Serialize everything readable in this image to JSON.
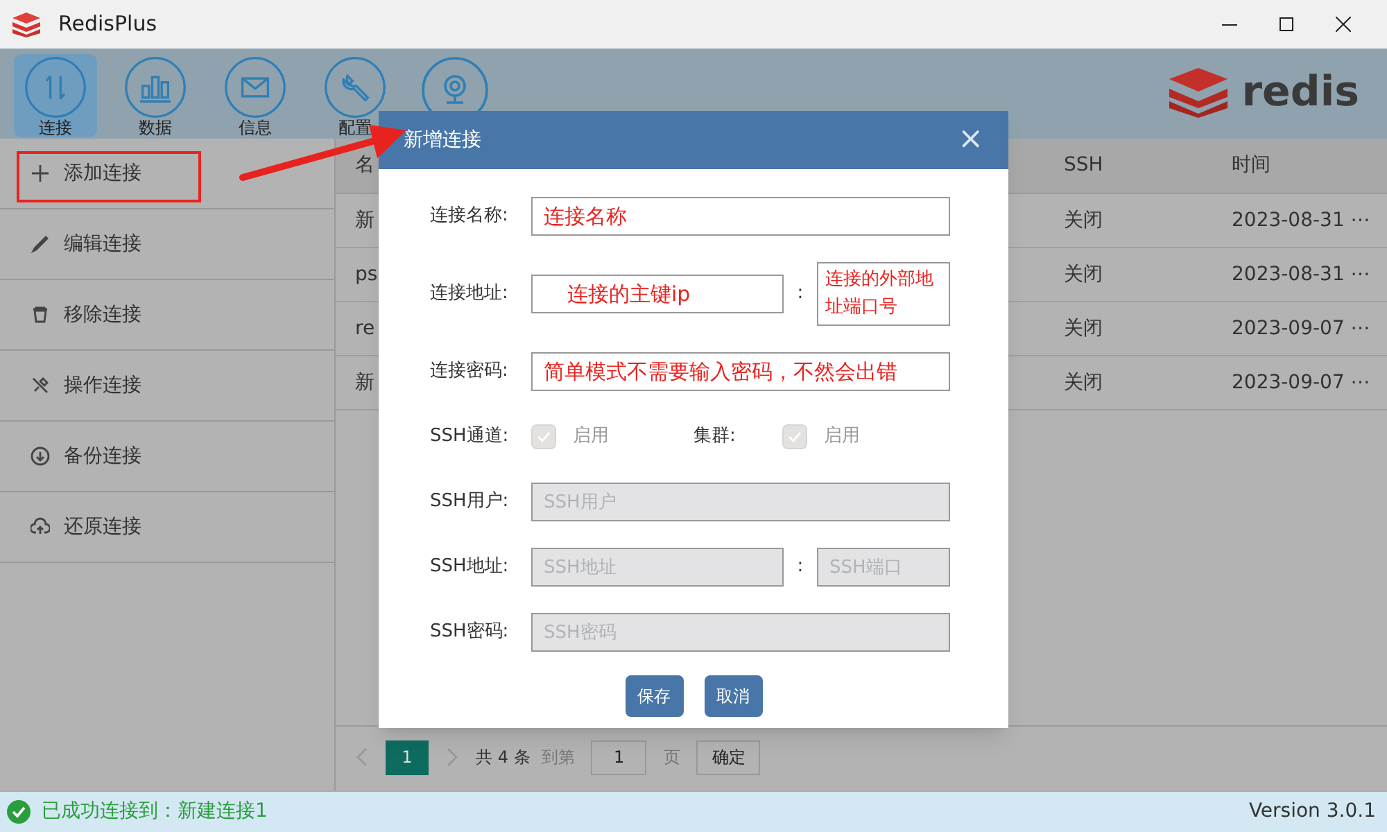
{
  "window": {
    "title": "RedisPlus"
  },
  "toolbar": [
    {
      "label": "连接",
      "selected": true,
      "kind": "arrows"
    },
    {
      "label": "数据",
      "selected": false,
      "kind": "bars"
    },
    {
      "label": "信息",
      "selected": false,
      "kind": "mail"
    },
    {
      "label": "配置",
      "selected": false,
      "kind": "wrench"
    },
    {
      "selected": false,
      "kind": "camera"
    }
  ],
  "logo": {
    "text": "redis"
  },
  "sidebar": {
    "items": [
      {
        "label": "添加连接",
        "kind": "plus"
      },
      {
        "label": "编辑连接",
        "kind": "pencil"
      },
      {
        "label": "移除连接",
        "kind": "trash"
      },
      {
        "label": "操作连接",
        "kind": "tools"
      },
      {
        "label": "备份连接",
        "kind": "download"
      },
      {
        "label": "还原连接",
        "kind": "cloud"
      }
    ]
  },
  "table": {
    "columns": [
      "名",
      "SSH",
      "时间"
    ],
    "rows": [
      [
        "新",
        "关闭",
        "2023-08-31 ⋯"
      ],
      [
        "ps",
        "关闭",
        "2023-08-31 ⋯"
      ],
      [
        "re",
        "关闭",
        "2023-09-07 ⋯"
      ],
      [
        "新",
        "关闭",
        "2023-09-07 ⋯"
      ]
    ]
  },
  "pagination": {
    "page": "1",
    "total": "共 4 条",
    "goto": "到第",
    "goto_value": "1",
    "page_unit": "页",
    "confirm": "确定"
  },
  "dialog": {
    "title": "新增连接",
    "close": "×",
    "name": {
      "label": "连接名称:",
      "value": "连接名称"
    },
    "address": {
      "label": "连接地址:",
      "value": "连接的主键ip",
      "sep": ":",
      "port": "连接的外部地址端口号"
    },
    "password": {
      "label": "连接密码:",
      "value": "简单模式不需要输入密码，不然会出错"
    },
    "ssh_tunnel": {
      "label": "SSH通道:",
      "checked": true,
      "disabled": true,
      "option": "启用"
    },
    "cluster": {
      "label": "集群:",
      "checked": true,
      "disabled": true,
      "option": "启用"
    },
    "ssh_user": {
      "label": "SSH用户:",
      "placeholder": "SSH用户"
    },
    "ssh_address": {
      "label": "SSH地址:",
      "placeholder": "SSH地址",
      "sep": ":",
      "port_placeholder": "SSH端口"
    },
    "ssh_password": {
      "label": "SSH密码:",
      "placeholder": "SSH密码"
    },
    "buttons": [
      "保存",
      "取消"
    ]
  },
  "status_bar": {
    "message": "已成功连接到：新建连接1",
    "version": "Version 3.0.1"
  }
}
